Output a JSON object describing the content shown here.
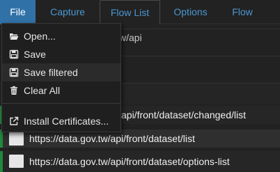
{
  "menubar": {
    "tabs": {
      "file": "File",
      "capture": "Capture",
      "flow_list": "Flow List",
      "options": "Options",
      "flow": "Flow"
    },
    "active_tab": "Flow List",
    "open_menu": "File"
  },
  "colors": {
    "background": "#222222",
    "file_tab_active": "#3072a8",
    "tab_text": "#4b97d3",
    "menu_bg": "#1f1f1f",
    "status_success": "#1e8a3a"
  },
  "file_menu": {
    "items": [
      {
        "label": "Open...",
        "icon": "folder-open-icon"
      },
      {
        "label": "Save",
        "icon": "floppy-disk-icon"
      },
      {
        "label": "Save filtered",
        "icon": "floppy-disk-icon"
      },
      {
        "label": "Clear All",
        "icon": "trash-icon"
      },
      {
        "label": "Install Certificates...",
        "icon": "external-link-icon"
      }
    ],
    "hovered_item": "Save filtered"
  },
  "filter": {
    "visible_text": "w/api"
  },
  "flows": [
    {
      "url": "api/front/dataset/changed/list",
      "status": "success"
    },
    {
      "url": "https://data.gov.tw/api/front/dataset/list",
      "status": "success"
    },
    {
      "url": "https://data.gov.tw/api/front/dataset/options-list",
      "status": "success"
    }
  ]
}
